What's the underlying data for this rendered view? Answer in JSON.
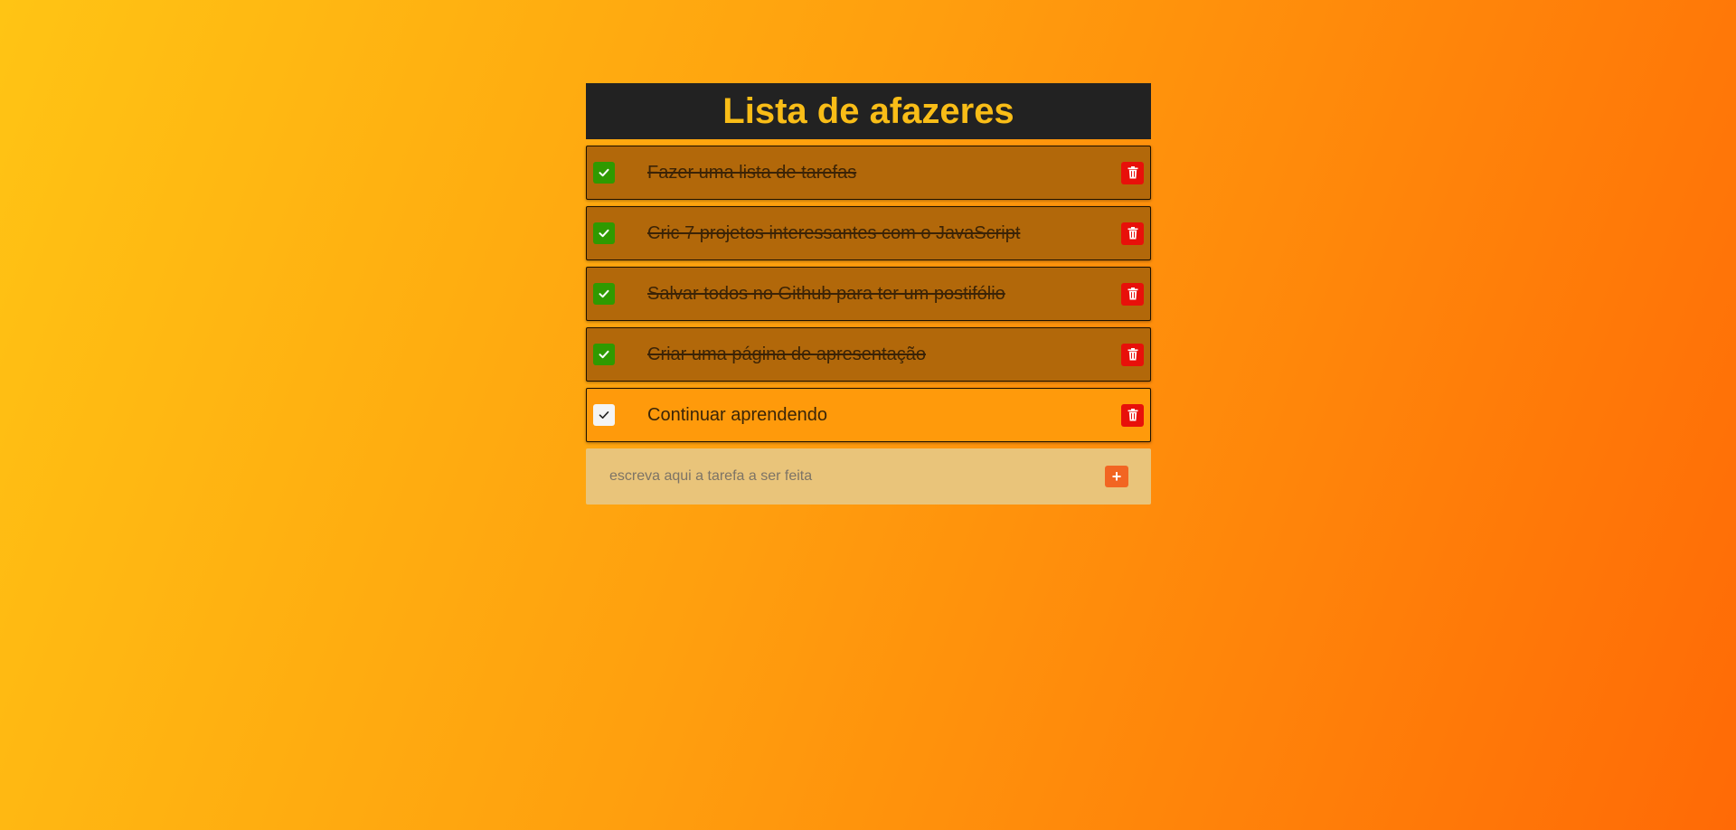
{
  "header": {
    "title": "Lista de afazeres"
  },
  "tasks": [
    {
      "label": "Fazer uma lista de tarefas",
      "done": true
    },
    {
      "label": "Cric 7 projetos interessantes com o JavaScript",
      "done": true
    },
    {
      "label": "Salvar todos no Github para ter um postifólio",
      "done": true
    },
    {
      "label": "Criar uma página de apresentação",
      "done": true
    },
    {
      "label": "Continuar aprendendo",
      "done": false
    }
  ],
  "add_form": {
    "placeholder": "escreva aqui a tarefa a ser feita",
    "value": "",
    "button_label": "+"
  },
  "icons": {
    "check": "check-icon",
    "delete": "trash-icon",
    "add": "plus-icon"
  },
  "colors": {
    "title": "#f9bd17",
    "header_bg": "#222222",
    "done_bg": "#b2680a",
    "pending_bg": "#ff9a0b",
    "check_done": "#2f9a00",
    "delete_button": "#e8100a",
    "add_button": "#f26522",
    "input_bg": "#e9c47a"
  }
}
